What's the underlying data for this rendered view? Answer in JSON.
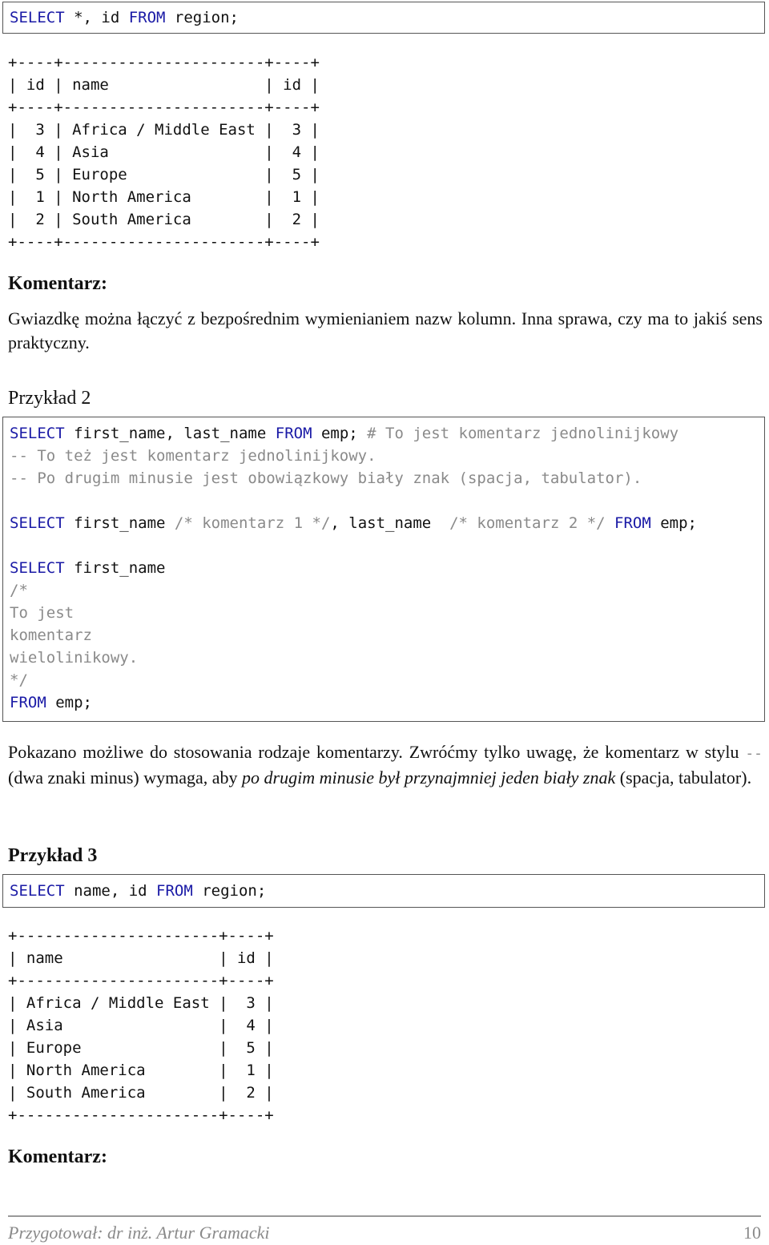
{
  "example1": {
    "query": {
      "kw1": "SELECT",
      "p1": " *, id ",
      "kw2": "FROM",
      "p2": " region;"
    },
    "result_table": {
      "border": "+----+----------------------+----+",
      "header": "| id | name                 | id |",
      "rows": [
        "|  3 | Africa / Middle East |  3 |",
        "|  4 | Asia                 |  4 |",
        "|  5 | Europe               |  5 |",
        "|  1 | North America        |  1 |",
        "|  2 | South America        |  2 |"
      ]
    },
    "comment_heading": "Komentarz:",
    "comment_text": "Gwiazdkę można łączyć z bezpośrednim wymienianiem nazw kolumn. Inna sprawa, czy ma to jakiś sens praktyczny."
  },
  "example2": {
    "heading": "Przykład 2",
    "lines": {
      "l1": {
        "kw1": "SELECT",
        "p1": " first_name, last_name ",
        "kw2": "FROM",
        "p2": " emp; ",
        "cm": "# To jest komentarz jednolinijkowy"
      },
      "l2": {
        "cm": "-- To też jest komentarz jednolinijkowy."
      },
      "l3": {
        "cm": "-- Po drugim minusie jest obowiązkowy biały znak (spacja, tabulator)."
      },
      "l4": {
        "kw1": "SELECT",
        "p1": " first_name ",
        "cm1": "/* komentarz 1 */",
        "p2": ", last_name  ",
        "cm2": "/* komentarz 2 */",
        "p3": " ",
        "kw2": "FROM",
        "p4": " emp;"
      },
      "l5": {
        "kw1": "SELECT",
        "p1": " first_name"
      },
      "l6": {
        "cm": "/*"
      },
      "l7": {
        "cm": "To jest"
      },
      "l8": {
        "cm": "komentarz"
      },
      "l9": {
        "cm": "wielolinikowy."
      },
      "l10": {
        "cm": "*/"
      },
      "l11": {
        "kw1": "FROM",
        "p1": " emp;"
      }
    },
    "explanation": {
      "part1": "Pokazano możliwe do stosowania rodzaje komentarzy. Zwróćmy tylko uwagę, że komentarz w stylu ",
      "dashes": "--",
      "part2": " (dwa znaki minus) wymaga, aby ",
      "emphasis": "po drugim minusie był przynajmniej jeden biały znak",
      "part3": " (spacja, tabulator)."
    }
  },
  "example3": {
    "heading": "Przykład 3",
    "query": {
      "kw1": "SELECT",
      "p1": " name, id ",
      "kw2": "FROM",
      "p2": " region;"
    },
    "result_table": {
      "border": "+----------------------+----+",
      "header": "| name                 | id |",
      "rows": [
        "| Africa / Middle East |  3 |",
        "| Asia                 |  4 |",
        "| Europe               |  5 |",
        "| North America        |  1 |",
        "| South America        |  2 |"
      ]
    },
    "comment_heading": "Komentarz:"
  },
  "footer": {
    "author": "Przygotował: dr inż. Artur Gramacki",
    "page_number": "10"
  },
  "colors": {
    "keyword": "#1a1aa6",
    "comment": "#8a8a8a",
    "text": "#111111"
  }
}
